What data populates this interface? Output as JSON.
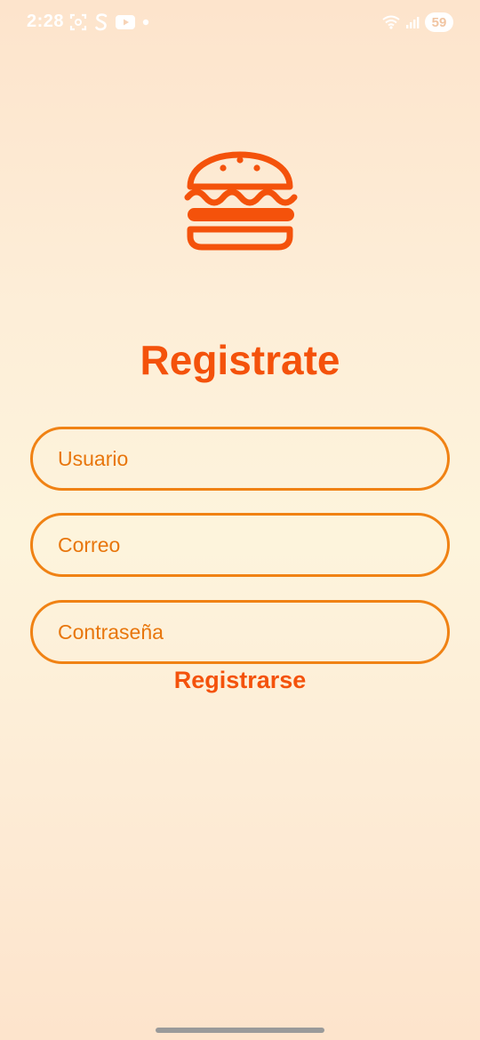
{
  "status_bar": {
    "time": "2:28",
    "battery": "59",
    "icons": [
      "screenshot-icon",
      "s-app-icon",
      "youtube-icon",
      "dot-icon",
      "wifi-icon",
      "signal-icon"
    ]
  },
  "colors": {
    "accent": "#f4520b",
    "field_border": "#f08214",
    "placeholder": "#e8760c"
  },
  "logo": {
    "icon": "burger-icon"
  },
  "form": {
    "title": "Registrate",
    "username_placeholder": "Usuario",
    "email_placeholder": "Correo",
    "password_placeholder": "Contraseña",
    "submit_label": "Registrarse"
  }
}
